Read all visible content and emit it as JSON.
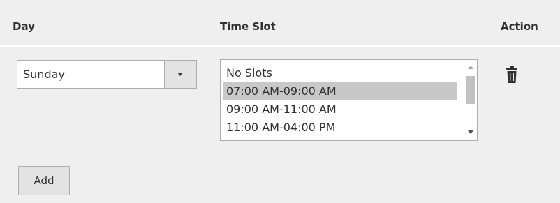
{
  "table": {
    "headers": {
      "day": "Day",
      "time_slot": "Time Slot",
      "action": "Action"
    },
    "rows": [
      {
        "day_selected": "Sunday",
        "time_slot_options": [
          {
            "label": "No Slots",
            "selected": false
          },
          {
            "label": "07:00 AM-09:00 AM",
            "selected": true
          },
          {
            "label": "09:00 AM-11:00 AM",
            "selected": false
          },
          {
            "label": "11:00 AM-04:00 PM",
            "selected": false
          }
        ],
        "action_icon": "trash-icon"
      }
    ]
  },
  "footer": {
    "add_label": "Add"
  },
  "colors": {
    "row_background": "#efefef",
    "selected_option": "#c8c8c8",
    "button_background": "#e3e3e3",
    "border": "#adadad",
    "text": "#303030"
  }
}
